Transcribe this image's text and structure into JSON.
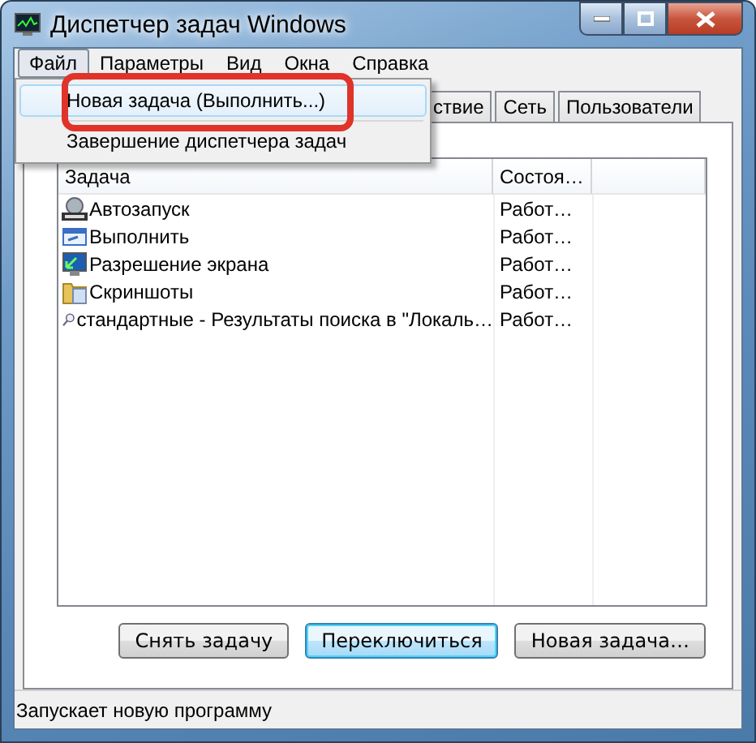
{
  "window": {
    "title": "Диспетчер задач Windows"
  },
  "menu_bar": [
    {
      "label": "Файл",
      "selected": true
    },
    {
      "label": "Параметры",
      "selected": false
    },
    {
      "label": "Вид",
      "selected": false
    },
    {
      "label": "Окна",
      "selected": false
    },
    {
      "label": "Справка",
      "selected": false
    }
  ],
  "file_menu": [
    {
      "label": "Новая задача (Выполнить...)",
      "selected": true,
      "annotated": true
    },
    {
      "label": "Завершение диспетчера задач",
      "selected": false,
      "annotated": false
    }
  ],
  "tabs": [
    {
      "label": "ствие",
      "selected": false
    },
    {
      "label": "Сеть",
      "selected": false
    },
    {
      "label": "Пользователи",
      "selected": false
    }
  ],
  "table": {
    "columns": [
      "Задача",
      "Состоя…"
    ],
    "rows": [
      {
        "task": "Автозапуск",
        "status": "Работ…"
      },
      {
        "task": "Выполнить",
        "status": "Работ…"
      },
      {
        "task": "Разрешение экрана",
        "status": "Работ…"
      },
      {
        "task": "Скриншоты",
        "status": "Работ…"
      },
      {
        "task": "стандартные - Результаты поиска в \"Локаль…",
        "status": "Работ…"
      }
    ]
  },
  "buttons": [
    {
      "label": "Снять задачу",
      "default": false
    },
    {
      "label": "Переключиться",
      "default": true
    },
    {
      "label": "Новая задача…",
      "default": false
    }
  ],
  "status_bar": "Запускает новую программу"
}
